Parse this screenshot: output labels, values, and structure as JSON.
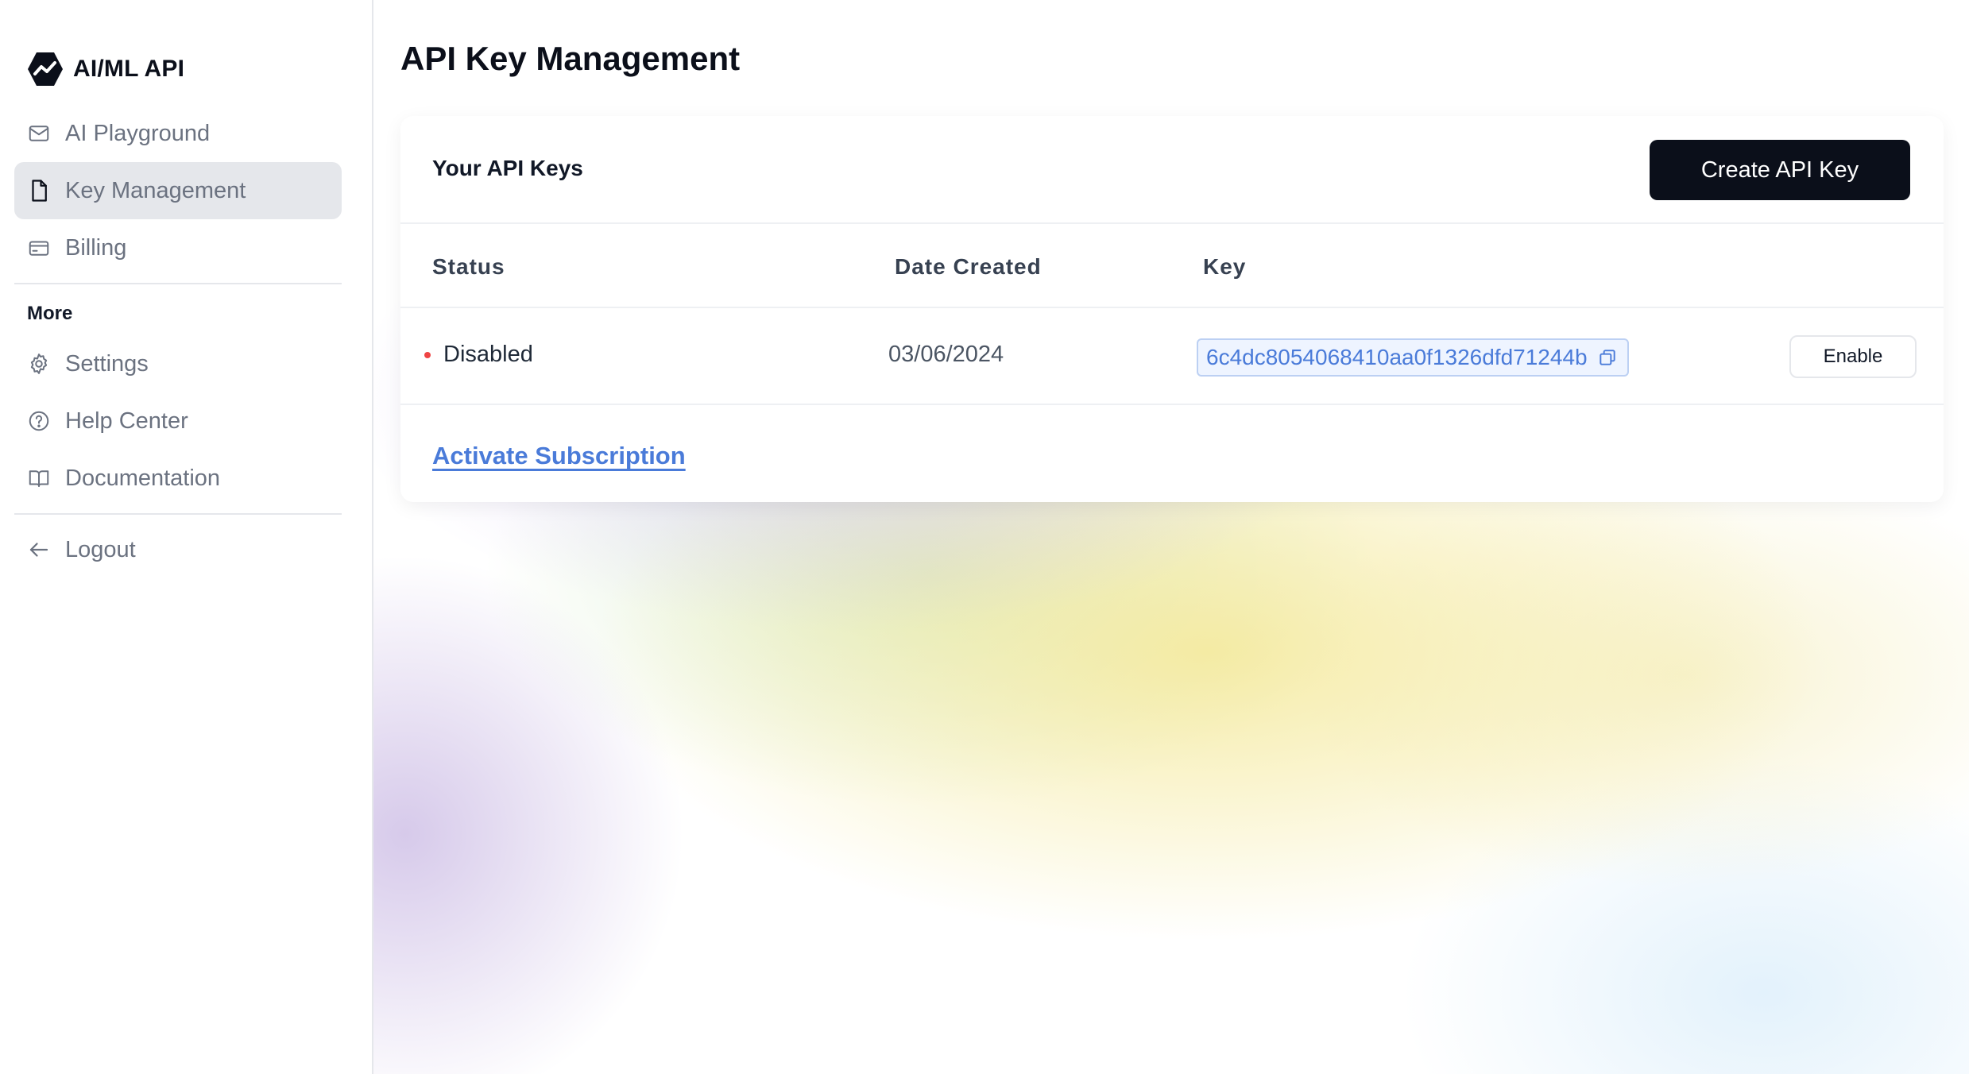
{
  "sidebar": {
    "brand": "AI/ML API",
    "items": [
      {
        "label": "AI Playground",
        "icon": "mail-icon"
      },
      {
        "label": "Key Management",
        "icon": "document-icon",
        "active": true
      },
      {
        "label": "Billing",
        "icon": "credit-card-icon"
      }
    ],
    "section_label": "More",
    "more_items": [
      {
        "label": "Settings",
        "icon": "gear-icon"
      },
      {
        "label": "Help Center",
        "icon": "help-circle-icon"
      },
      {
        "label": "Documentation",
        "icon": "book-icon"
      }
    ],
    "logout": {
      "label": "Logout",
      "icon": "arrow-left-icon"
    }
  },
  "main": {
    "title": "API Key Management",
    "card": {
      "title": "Your API Keys",
      "create_button": "Create API Key",
      "columns": [
        "Status",
        "Date Created",
        "Key"
      ],
      "rows": [
        {
          "status": "Disabled",
          "status_color": "#ef4444",
          "date_created": "03/06/2024",
          "key": "6c4dc8054068410aa0f1326dfd71244b",
          "action": "Enable"
        }
      ],
      "activate_link": "Activate Subscription"
    }
  },
  "colors": {
    "primary_button": "#0b0f1a",
    "link": "#4a7bd9",
    "active_nav_bg": "#e5e7eb"
  }
}
